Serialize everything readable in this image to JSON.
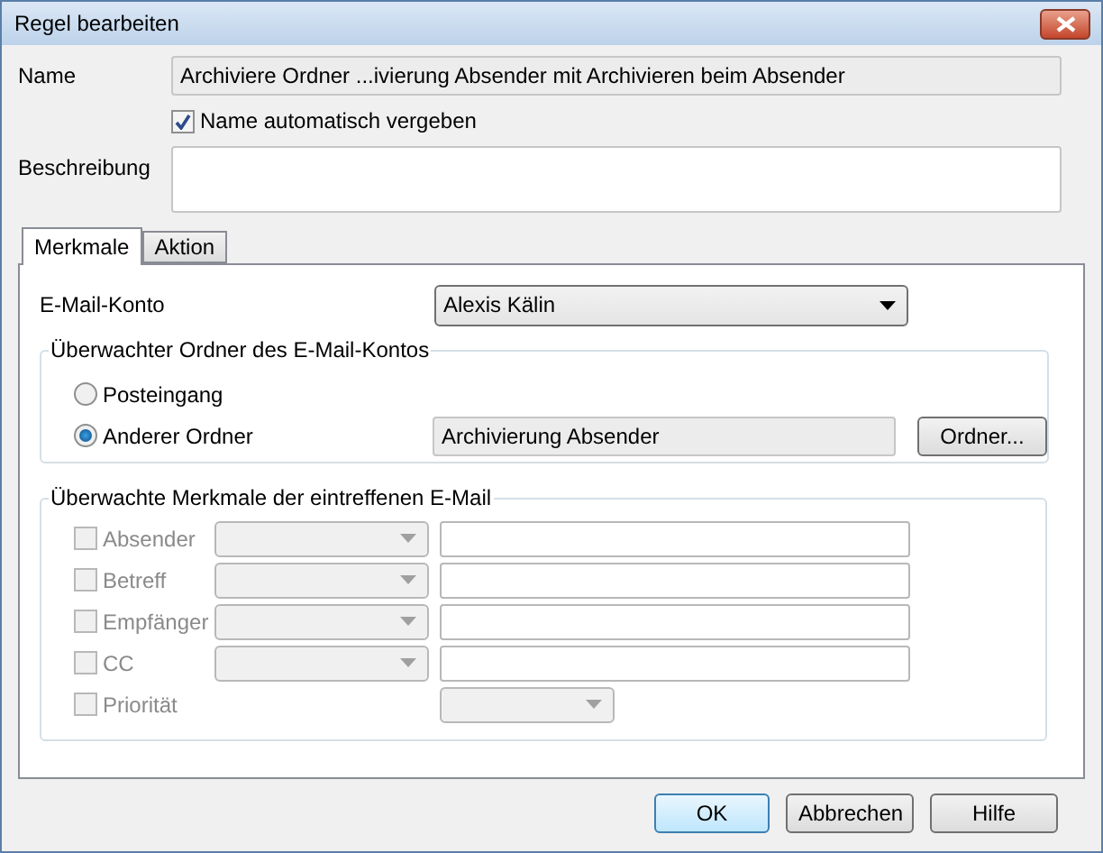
{
  "window": {
    "title": "Regel bearbeiten"
  },
  "name": {
    "label": "Name",
    "value": "Archiviere Ordner ...ivierung Absender mit Archivieren beim Absender"
  },
  "auto_name": {
    "label": "Name automatisch vergeben",
    "checked": true
  },
  "description": {
    "label": "Beschreibung"
  },
  "tabs": [
    {
      "label": "Merkmale",
      "selected": true
    },
    {
      "label": "Aktion",
      "selected": false
    }
  ],
  "account": {
    "label": "E-Mail-Konto",
    "value": "Alexis Kälin"
  },
  "folder_group": {
    "title": "Überwachter Ordner des E-Mail-Kontos",
    "options": [
      {
        "label": "Posteingang",
        "selected": false
      },
      {
        "label": "Anderer Ordner",
        "selected": true
      }
    ],
    "folder": "Archivierung Absender",
    "button": "Ordner..."
  },
  "criteria_group": {
    "title": "Überwachte Merkmale der eintreffenen E-Mail",
    "rows": [
      {
        "label": "Absender",
        "kind": "combo_text",
        "checked": false,
        "disabled": true
      },
      {
        "label": "Betreff",
        "kind": "combo_text",
        "checked": false,
        "disabled": true
      },
      {
        "label": "Empfänger",
        "kind": "combo_text",
        "checked": false,
        "disabled": true
      },
      {
        "label": "CC",
        "kind": "combo_text",
        "checked": false,
        "disabled": true
      },
      {
        "label": "Priorität",
        "kind": "small_combo",
        "checked": false,
        "disabled": true
      }
    ]
  },
  "buttons": [
    {
      "label": "OK",
      "default": true
    },
    {
      "label": "Abbrechen",
      "default": false
    },
    {
      "label": "Hilfe",
      "default": false
    }
  ]
}
